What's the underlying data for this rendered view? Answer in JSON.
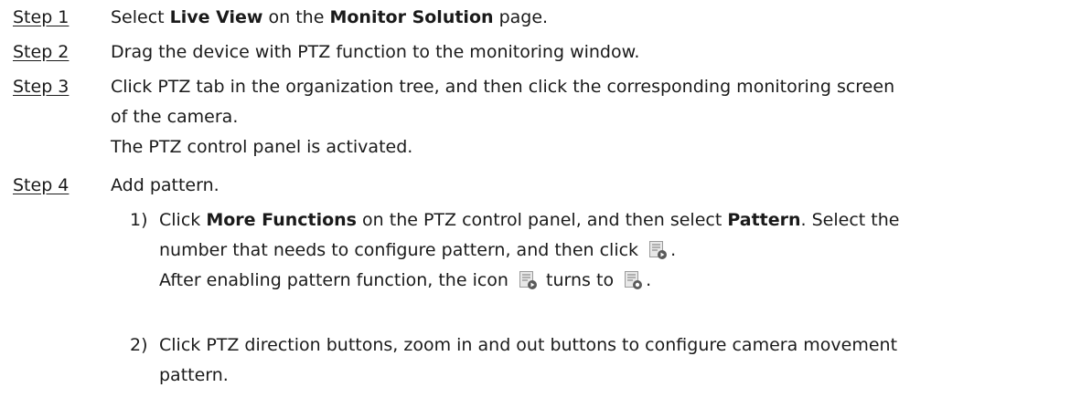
{
  "steps": [
    {
      "label": "Step 1",
      "l1_a": "Select ",
      "l1_b1": "Live View",
      "l1_c": " on the ",
      "l1_b2": "Monitor Solution",
      "l1_d": " page."
    },
    {
      "label": "Step 2",
      "l1": "Drag the device with PTZ function to the monitoring window."
    },
    {
      "label": "Step 3",
      "l1": "Click PTZ tab in the organization tree, and then click the corresponding monitoring screen",
      "l2": "of the camera.",
      "l3": "The PTZ control panel is activated."
    },
    {
      "label": "Step 4",
      "l1": "Add pattern.",
      "subs": [
        {
          "num": "1)",
          "l1_a": "Click ",
          "l1_b1": "More Functions",
          "l1_c": " on the PTZ control panel, and then select ",
          "l1_b2": "Pattern",
          "l1_d": ". Select the",
          "l2_a": "number that needs to configure pattern, and then click ",
          "l2_b": ".",
          "l3_a": "After enabling pattern function, the icon ",
          "l3_b": " turns to ",
          "l3_c": "."
        },
        {
          "num": "2)",
          "l1": "Click PTZ direction buttons, zoom in and out buttons to configure camera movement",
          "l2": "pattern."
        }
      ]
    }
  ],
  "icons": {
    "pattern_icon": "pattern-start-icon",
    "pattern_icon_enabled": "pattern-recording-icon",
    "color_doc": "#e8e8e8",
    "color_doc_border": "#9a9a9a",
    "color_badge": "#5a5a5a"
  }
}
